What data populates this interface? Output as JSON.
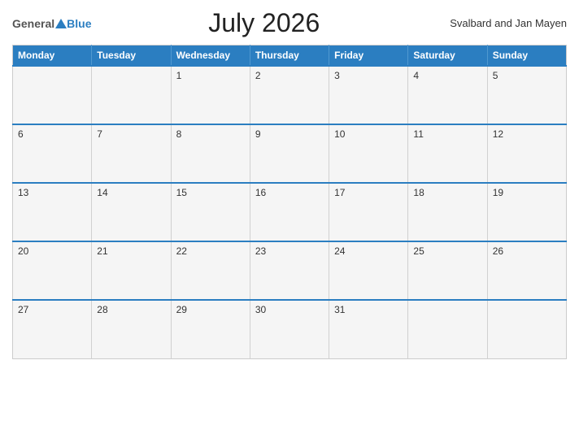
{
  "header": {
    "logo_general": "General",
    "logo_blue": "Blue",
    "month_title": "July 2026",
    "region": "Svalbard and Jan Mayen"
  },
  "weekdays": [
    "Monday",
    "Tuesday",
    "Wednesday",
    "Thursday",
    "Friday",
    "Saturday",
    "Sunday"
  ],
  "weeks": [
    [
      "",
      "",
      "1",
      "2",
      "3",
      "4",
      "5"
    ],
    [
      "6",
      "7",
      "8",
      "9",
      "10",
      "11",
      "12"
    ],
    [
      "13",
      "14",
      "15",
      "16",
      "17",
      "18",
      "19"
    ],
    [
      "20",
      "21",
      "22",
      "23",
      "24",
      "25",
      "26"
    ],
    [
      "27",
      "28",
      "29",
      "30",
      "31",
      "",
      ""
    ]
  ]
}
